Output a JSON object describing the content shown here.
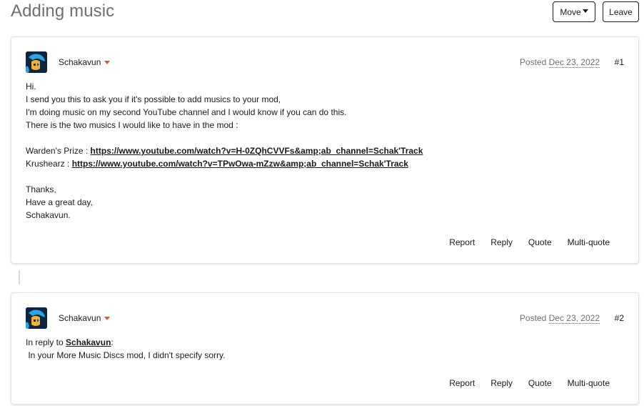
{
  "page": {
    "title": "Adding music",
    "move_label": "Move",
    "leave_label": "Leave"
  },
  "posts": [
    {
      "author": "Schakavun",
      "posted_prefix": "Posted",
      "date": "Dec 23, 2022",
      "number": "#1",
      "lines": [
        "Hi.",
        "I send you this to ask you if it's possible to add musics to your mod,",
        "I'm doing music on my second YouTube channel and I would know if you can do this.",
        "There is the two musics I would like to have in the mod :"
      ],
      "links": [
        {
          "label": "Warden's Prize : ",
          "url": "https://www.youtube.com/watch?v=H-0ZQhCVVFs&amp;ab_channel=Schak'Track"
        },
        {
          "label": "Krushearz : ",
          "url": "https://www.youtube.com/watch?v=TPwOwa-mZzw&amp;ab_channel=Schak'Track"
        }
      ],
      "closing": [
        "Thanks,",
        "Have a great day,",
        "Schakavun."
      ],
      "actions": {
        "report": "Report",
        "reply": "Reply",
        "quote": "Quote",
        "multiquote": "Multi-quote"
      }
    },
    {
      "author": "Schakavun",
      "posted_prefix": "Posted",
      "date": "Dec 23, 2022",
      "number": "#2",
      "reply_prefix": "In reply to ",
      "reply_user": "Schakavun",
      "reply_suffix": ":",
      "text": " In your More Music Discs mod, I didn't specify sorry.",
      "actions": {
        "report": "Report",
        "reply": "Reply",
        "quote": "Quote",
        "multiquote": "Multi-quote"
      }
    }
  ],
  "colors": {
    "accent": "#e0562a",
    "muted": "#6b6f77"
  },
  "icons": {
    "author_menu": "caret-down-icon",
    "move_menu": "caret-down-icon"
  }
}
